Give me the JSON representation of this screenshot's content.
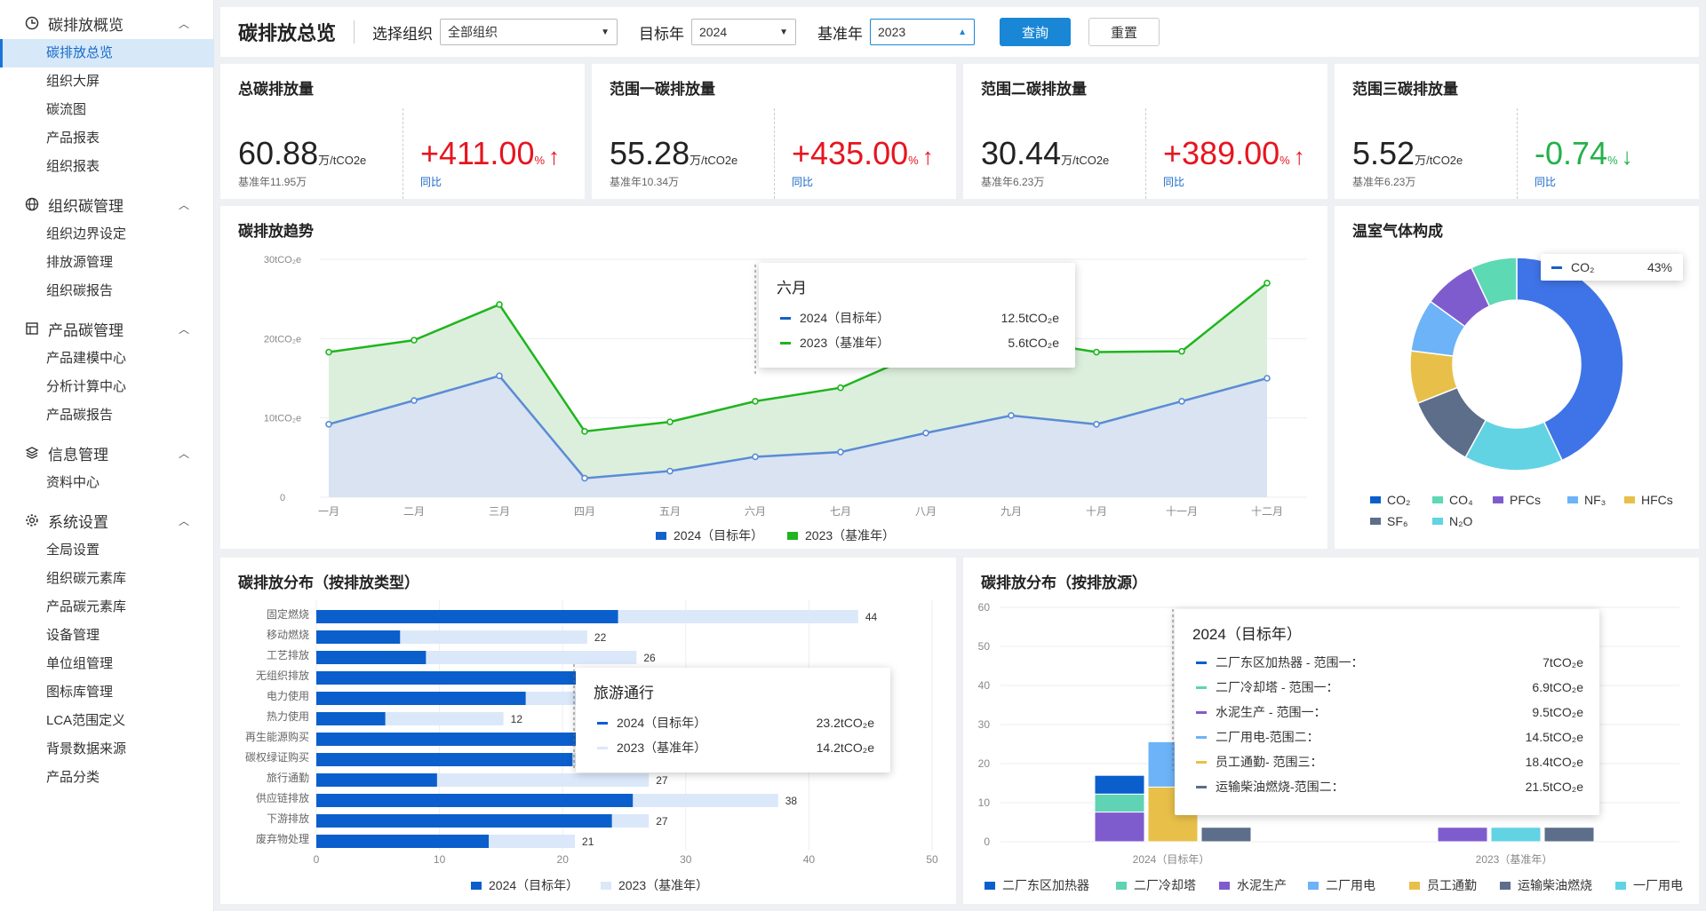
{
  "sidebar": {
    "groups": [
      {
        "label": "碳排放概览",
        "icon": "pie-clock-icon",
        "items": [
          "碳排放总览",
          "组织大屏",
          "碳流图",
          "产品报表",
          "组织报表"
        ]
      },
      {
        "label": "组织碳管理",
        "icon": "globe-icon",
        "items": [
          "组织边界设定",
          "排放源管理",
          "组织碳报告"
        ]
      },
      {
        "label": "产品碳管理",
        "icon": "table-icon",
        "items": [
          "产品建模中心",
          "分析计算中心",
          "产品碳报告"
        ]
      },
      {
        "label": "信息管理",
        "icon": "layers-icon",
        "items": [
          "资料中心"
        ]
      },
      {
        "label": "系统设置",
        "icon": "gear-icon",
        "items": [
          "全局设置",
          "组织碳元素库",
          "产品碳元素库",
          "设备管理",
          "单位组管理",
          "图标库管理",
          "LCA范围定义",
          "背景数据来源",
          "产品分类"
        ]
      }
    ],
    "active": "碳排放总览"
  },
  "topbar": {
    "title": "碳排放总览",
    "org_label": "选择组织",
    "org_value": "全部组织",
    "target_label": "目标年",
    "target_value": "2024",
    "base_label": "基准年",
    "base_value": "2023",
    "query_btn": "查詢",
    "reset_btn": "重置"
  },
  "kpis": [
    {
      "title": "总碳排放量",
      "value": "60.88",
      "unit": "万/tCO2e",
      "base": "基准年11.95万",
      "change": "+411.00",
      "pct": "%",
      "arrow": "↑",
      "dir": "up",
      "yoy": "同比"
    },
    {
      "title": "范围一碳排放量",
      "value": "55.28",
      "unit": "万/tCO2e",
      "base": "基准年10.34万",
      "change": "+435.00",
      "pct": "%",
      "arrow": "↑",
      "dir": "up",
      "yoy": "同比"
    },
    {
      "title": "范围二碳排放量",
      "value": "30.44",
      "unit": "万/tCO2e",
      "base": "基准年6.23万",
      "change": "+389.00",
      "pct": "%",
      "arrow": "↑",
      "dir": "up",
      "yoy": "同比"
    },
    {
      "title": "范围三碳排放量",
      "value": "5.52",
      "unit": "万/tCO2e",
      "base": "基准年6.23万",
      "change": "-0.74",
      "pct": "%",
      "arrow": "↓",
      "dir": "down",
      "yoy": "同比"
    }
  ],
  "chart_data": [
    {
      "type": "area",
      "title": "碳排放趋势",
      "x": [
        "一月",
        "二月",
        "三月",
        "四月",
        "五月",
        "六月",
        "七月",
        "八月",
        "九月",
        "十月",
        "十一月",
        "十二月"
      ],
      "yticks": [
        "0",
        "10tCO₂e",
        "20tCO₂e",
        "30tCO₂e"
      ],
      "ylim": [
        0,
        30
      ],
      "series": [
        {
          "name": "2024（目标年）",
          "color": "#5b8bd6",
          "values": [
            9.2,
            12.2,
            15.3,
            2.4,
            3.3,
            5.1,
            5.7,
            8.1,
            10.3,
            9.2,
            12.1,
            15
          ]
        },
        {
          "name": "2023（基准年）",
          "color": "#1fb51f",
          "values": [
            18.3,
            19.8,
            24.3,
            8.3,
            9.5,
            12.1,
            13.8,
            18.5,
            20,
            18.3,
            18.4,
            27
          ]
        }
      ],
      "tooltip": {
        "title": "六月",
        "rows": [
          {
            "label": "2024（目标年）",
            "value": "12.5tCO₂e",
            "color": "#1461c9"
          },
          {
            "label": "2023（基准年）",
            "value": "5.6tCO₂e",
            "color": "#1fb51f"
          }
        ]
      }
    },
    {
      "type": "pie",
      "title": "温室气体构成",
      "slices": [
        {
          "name": "CO₂",
          "value": 43,
          "color": "#3f74e8"
        },
        {
          "name": "N₂O",
          "value": 15,
          "color": "#61d3e3"
        },
        {
          "name": "SF₆",
          "value": 11,
          "color": "#5d6e8a"
        },
        {
          "name": "HFCs",
          "value": 8,
          "color": "#e8c049"
        },
        {
          "name": "NF₃",
          "value": 8,
          "color": "#6cb3f7"
        },
        {
          "name": "PFCs",
          "value": 8,
          "color": "#7f5cce"
        },
        {
          "name": "CO₄",
          "value": 7,
          "color": "#5dd9b4"
        }
      ],
      "legend_order": [
        "CO₂",
        "CO₄",
        "PFCs",
        "NF₃",
        "HFCs",
        "SF₆",
        "N₂O"
      ],
      "tooltip": {
        "label": "CO₂",
        "value": "43%"
      }
    },
    {
      "type": "bar",
      "title": "碳排放分布（按排放类型）",
      "categories": [
        "固定燃烧",
        "移动燃烧",
        "工艺排放",
        "无组织排放",
        "电力使用",
        "热力使用",
        "再生能源购买",
        "碳权绿证购买",
        "旅行通勤",
        "供应链排放",
        "下游排放",
        "废弃物处理"
      ],
      "xticks": [
        "0",
        "10",
        "20",
        "30",
        "40",
        "50"
      ],
      "xlim": [
        0,
        50
      ],
      "series": [
        {
          "name": "2024（目标年）",
          "color": "#0a5fcc",
          "values": [
            24.5,
            6.8,
            8.9,
            23.9,
            17,
            5.6,
            21.5,
            20.8,
            9.8,
            25.7,
            24,
            14
          ]
        },
        {
          "name": "2023（基准年）",
          "color": "#dbe8fa",
          "values": [
            44,
            22,
            26,
            43.5,
            36,
            15.2,
            42,
            41.5,
            27,
            37.5,
            27,
            21
          ],
          "labels": [
            "44",
            "22",
            "26",
            "",
            "",
            "12",
            "",
            "",
            "27",
            "38",
            "27",
            "21"
          ]
        }
      ],
      "tooltip": {
        "title": "旅游通行",
        "rows": [
          {
            "label": "2024（目标年）",
            "value": "23.2tCO₂e",
            "color": "#0a5fcc"
          },
          {
            "label": "2023（基准年）",
            "value": "14.2tCO₂e",
            "color": "#dbe8fa"
          }
        ]
      }
    },
    {
      "type": "stacked-bar",
      "title": "碳排放分布（按排放源）",
      "categories": [
        "2024（目标年）",
        "2023（基准年）"
      ],
      "yticks": [
        "0",
        "10",
        "20",
        "30",
        "40",
        "50",
        "60"
      ],
      "ylim": [
        0,
        60
      ],
      "series": [
        {
          "name": "二厂东区加热器",
          "color": "#0a5fcc"
        },
        {
          "name": "二厂冷却塔",
          "color": "#5fd3b4"
        },
        {
          "name": "水泥生产",
          "color": "#7f5cce"
        },
        {
          "name": "二厂用电",
          "color": "#6cb3f7"
        },
        {
          "name": "员工通勤",
          "color": "#e8c049"
        },
        {
          "name": "运输柴油燃烧",
          "color": "#5d6e8a"
        },
        {
          "name": "一厂用电",
          "color": "#61d3e3"
        }
      ],
      "stacks": [
        {
          "bar": "2024-a",
          "segments": [
            {
              "s": "水泥生产",
              "v": 7.6
            },
            {
              "s": "二厂冷却塔",
              "v": 4.6
            },
            {
              "s": "二厂东区加热器",
              "v": 4.8
            }
          ]
        },
        {
          "bar": "2024-b",
          "segments": [
            {
              "s": "员工通勤",
              "v": 14
            },
            {
              "s": "二厂用电",
              "v": 11.6
            }
          ]
        },
        {
          "bar": "2024-c",
          "segments": [
            {
              "s": "运输柴油燃烧",
              "v": 3.7
            }
          ]
        },
        {
          "bar": "2023-a",
          "segments": [
            {
              "s": "水泥生产",
              "v": 3.7
            }
          ]
        },
        {
          "bar": "2023-b",
          "segments": [
            {
              "s": "一厂用电",
              "v": 3.7
            }
          ]
        },
        {
          "bar": "2023-c",
          "segments": [
            {
              "s": "运输柴油燃烧",
              "v": 3.7
            }
          ]
        }
      ],
      "tooltip": {
        "title": "2024（目标年）",
        "rows": [
          {
            "label": "二厂东区加热器 - 范围一：",
            "value": "7tCO₂e",
            "color": "#0a5fcc"
          },
          {
            "label": "二厂冷却塔 - 范围一：",
            "value": "6.9tCO₂e",
            "color": "#5fd3b4"
          },
          {
            "label": "水泥生产 - 范围一：",
            "value": "9.5tCO₂e",
            "color": "#7f5cce"
          },
          {
            "label": "二厂用电-范围二：",
            "value": "14.5tCO₂e",
            "color": "#6cb3f7"
          },
          {
            "label": "员工通勤- 范围三：",
            "value": "18.4tCO₂e",
            "color": "#e8c049"
          },
          {
            "label": "运输柴油燃烧-范围二：",
            "value": "21.5tCO₂e",
            "color": "#5d6e8a"
          }
        ]
      }
    }
  ]
}
